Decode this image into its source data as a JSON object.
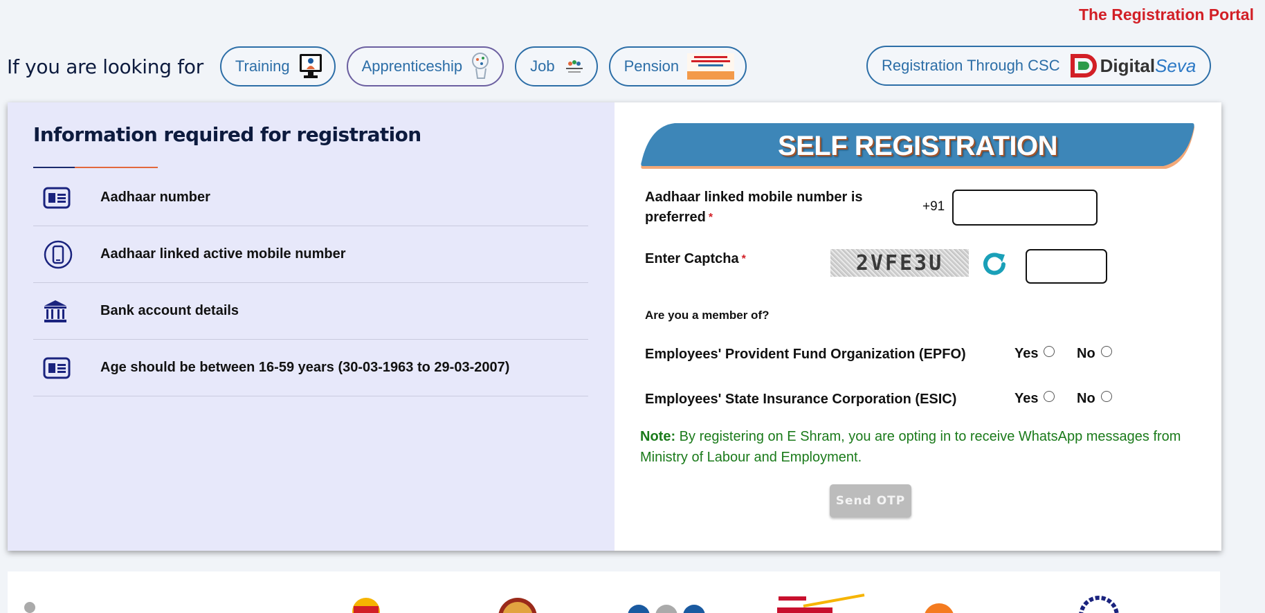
{
  "header": {
    "portal_title": "The Registration Portal"
  },
  "lookfor": {
    "label": "If you are looking for",
    "options": [
      {
        "label": "Training",
        "icon": "training-computer-icon"
      },
      {
        "label": "Apprenticeship",
        "icon": "apprenticeship-icon"
      },
      {
        "label": "Job",
        "icon": "job-portal-logo"
      },
      {
        "label": "Pension",
        "icon": "pm-sym-pension-logo"
      }
    ],
    "csc": {
      "label": "Registration Through CSC",
      "brand_main": "Digital",
      "brand_accent": "Seva"
    }
  },
  "info": {
    "title": "Information required for registration",
    "items": [
      {
        "text": "Aadhaar number",
        "icon": "id-card-icon"
      },
      {
        "text": "Aadhaar linked active mobile number",
        "icon": "mobile-phone-icon"
      },
      {
        "text": "Bank account details",
        "icon": "bank-icon"
      },
      {
        "text": "Age should be between 16-59 years (30-03-1963 to 29-03-2007)",
        "icon": "id-card-icon"
      }
    ]
  },
  "registration": {
    "banner": "SELF REGISTRATION",
    "mobile_label_line1": "Aadhaar linked mobile number is",
    "mobile_label_line2": "preferred",
    "required_mark": "*",
    "prefix": "+91",
    "mobile_value": "",
    "captcha_label": "Enter Captcha",
    "captcha_code": "2VFE3U",
    "captcha_value": "",
    "member_question": "Are you a member of?",
    "members": [
      {
        "label": "Employees' Provident Fund Organization (EPFO)",
        "yes": "Yes",
        "no": "No"
      },
      {
        "label": "Employees' State Insurance Corporation (ESIC)",
        "yes": "Yes",
        "no": "No"
      }
    ],
    "note_label": "Note:",
    "note_text": "By registering on E Shram, you are opting in to receive WhatsApp messages from Ministry of Labour and Employment.",
    "otp_button": "Send OTP"
  },
  "colors": {
    "portal_red": "#d21f26",
    "pill_blue": "#2c6ea7",
    "banner_blue": "#3d86b8",
    "info_bg": "#e7e8fa",
    "note_green": "#1a7a1a"
  }
}
